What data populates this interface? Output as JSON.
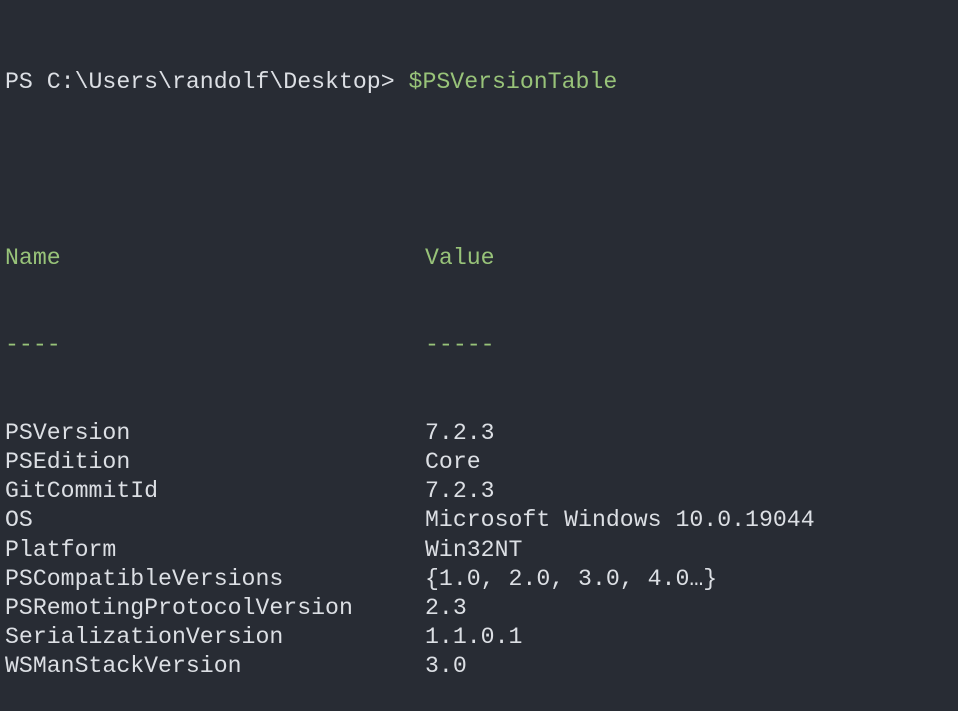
{
  "prompt": "PS C:\\Users\\randolf\\Desktop> ",
  "command": "$PSVersionTable",
  "headers": {
    "name": "Name",
    "value": "Value",
    "name_rule": "----",
    "value_rule": "-----"
  },
  "rows": [
    {
      "name": "PSVersion",
      "value": "7.2.3"
    },
    {
      "name": "PSEdition",
      "value": "Core"
    },
    {
      "name": "GitCommitId",
      "value": "7.2.3"
    },
    {
      "name": "OS",
      "value": "Microsoft Windows 10.0.19044"
    },
    {
      "name": "Platform",
      "value": "Win32NT"
    },
    {
      "name": "PSCompatibleVersions",
      "value": "{1.0, 2.0, 3.0, 4.0…}"
    },
    {
      "name": "PSRemotingProtocolVersion",
      "value": "2.3"
    },
    {
      "name": "SerializationVersion",
      "value": "1.1.0.1"
    },
    {
      "name": "WSManStackVersion",
      "value": "3.0"
    }
  ],
  "colors": {
    "background": "#282c34",
    "text": "#dcdfe4",
    "accent": "#98c379"
  }
}
